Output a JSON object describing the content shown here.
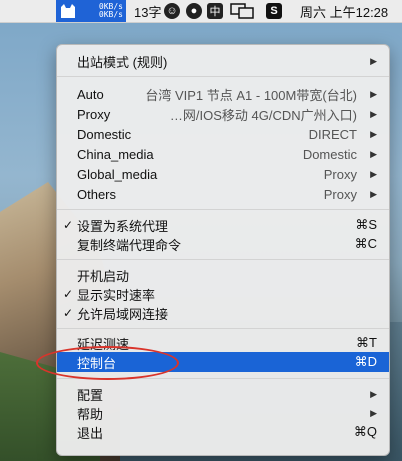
{
  "menubar": {
    "speed_up": "0KB/s",
    "speed_down": "0KB/s",
    "word_count": "13字",
    "ime_label": "中",
    "sogou_label": "S",
    "clock": "周六 上午12:28"
  },
  "menu": {
    "outbound_mode": "出站模式 (规则)",
    "auto_label": "Auto",
    "auto_value": "台湾 VIP1 节点 A1 - 100M带宽(台北)",
    "proxy_label": "Proxy",
    "proxy_value": "…网/IOS移动 4G/CDN广州入口)",
    "domestic_label": "Domestic",
    "domestic_value": "DIRECT",
    "china_media_label": "China_media",
    "china_media_value": "Domestic",
    "global_media_label": "Global_media",
    "global_media_value": "Proxy",
    "others_label": "Others",
    "others_value": "Proxy",
    "set_system_proxy": "设置为系统代理",
    "set_system_proxy_shortcut": "⌘S",
    "copy_terminal": "复制终端代理命令",
    "copy_terminal_shortcut": "⌘C",
    "launch_at_login": "开机启动",
    "show_speed": "显示实时速率",
    "allow_lan": "允许局域网连接",
    "latency_test": "延迟测速",
    "latency_shortcut": "⌘T",
    "dashboard": "控制台",
    "dashboard_shortcut": "⌘D",
    "config": "配置",
    "help": "帮助",
    "quit": "退出",
    "quit_shortcut": "⌘Q",
    "checkmark": "✓",
    "submenu_arrow": "▶"
  },
  "colors": {
    "selection": "#1a64d6",
    "annotation": "#d9342b"
  }
}
